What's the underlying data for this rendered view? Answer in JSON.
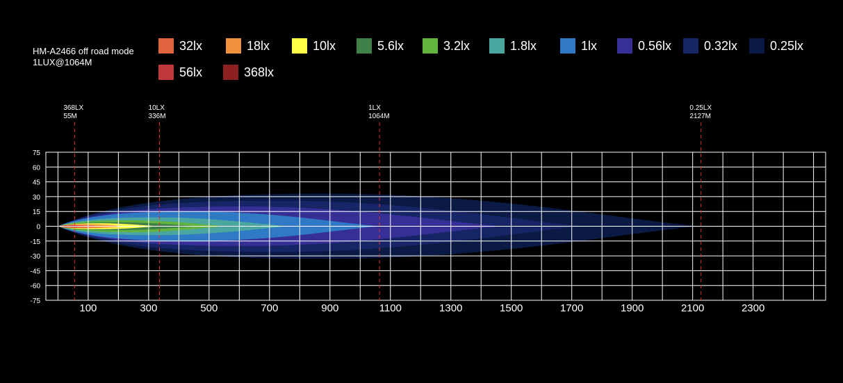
{
  "chart_data": {
    "type": "area",
    "title_lines": [
      "HM-A2466  off road mode",
      "1LUX@1064M"
    ],
    "legend": [
      {
        "label": "32lx",
        "color": "#e0643e"
      },
      {
        "label": "18lx",
        "color": "#f0903c"
      },
      {
        "label": "10lx",
        "color": "#ffff4a"
      },
      {
        "label": "5.6lx",
        "color": "#3f7f48"
      },
      {
        "label": "3.2lx",
        "color": "#63b43e"
      },
      {
        "label": "1.8lx",
        "color": "#4aa7a0"
      },
      {
        "label": "1lx",
        "color": "#3079c4"
      },
      {
        "label": "0.56lx",
        "color": "#362f96"
      },
      {
        "label": "0.32lx",
        "color": "#162566"
      },
      {
        "label": "0.25lx",
        "color": "#0b1a45"
      },
      {
        "label": "56lx",
        "color": "#c0393a"
      },
      {
        "label": "368lx",
        "color": "#8c1f1f"
      }
    ],
    "x_ticks": [
      "100",
      "300",
      "500",
      "700",
      "900",
      "1100",
      "1300",
      "1500",
      "1700",
      "1900",
      "2100",
      "2300"
    ],
    "y_ticks": [
      "75",
      "60",
      "45",
      "30",
      "15",
      "0",
      "-15",
      "-30",
      "-45",
      "-60",
      "-75"
    ],
    "xlim": [
      -40,
      2540
    ],
    "ylim": [
      -75,
      75
    ],
    "contours": [
      {
        "label": "0.25lx",
        "reach": 2127,
        "half_width": 33,
        "color": "#0b1a45"
      },
      {
        "label": "0.32lx",
        "reach": 1740,
        "half_width": 26,
        "color": "#162566"
      },
      {
        "label": "0.56lx",
        "reach": 1470,
        "half_width": 20,
        "color": "#362f96"
      },
      {
        "label": "1lx",
        "reach": 1064,
        "half_width": 15,
        "color": "#3079c4"
      },
      {
        "label": "1.8lx",
        "reach": 770,
        "half_width": 9,
        "color": "#4aa7a0"
      },
      {
        "label": "3.2lx",
        "reach": 560,
        "half_width": 6,
        "color": "#63b43e"
      },
      {
        "label": "5.6lx",
        "reach": 470,
        "half_width": 4,
        "color": "#3f7f48"
      },
      {
        "label": "10lx",
        "reach": 336,
        "half_width": 3,
        "color": "#ffff4a"
      },
      {
        "label": "18lx",
        "reach": 230,
        "half_width": 2,
        "color": "#f0903c"
      },
      {
        "label": "32lx",
        "reach": 150,
        "half_width": 1.5,
        "color": "#e0643e"
      },
      {
        "label": "56lx",
        "reach": 100,
        "half_width": 1,
        "color": "#c0393a"
      },
      {
        "label": "368lx",
        "reach": 55,
        "half_width": 0.5,
        "color": "#8c1f1f"
      }
    ],
    "markers": [
      {
        "lux": "368LX",
        "dist": "55M",
        "x": 55
      },
      {
        "lux": "10LX",
        "dist": "336M",
        "x": 336
      },
      {
        "lux": "1LX",
        "dist": "1064M",
        "x": 1064
      },
      {
        "lux": "0.25LX",
        "dist": "2127M",
        "x": 2127
      }
    ],
    "grid": true
  }
}
